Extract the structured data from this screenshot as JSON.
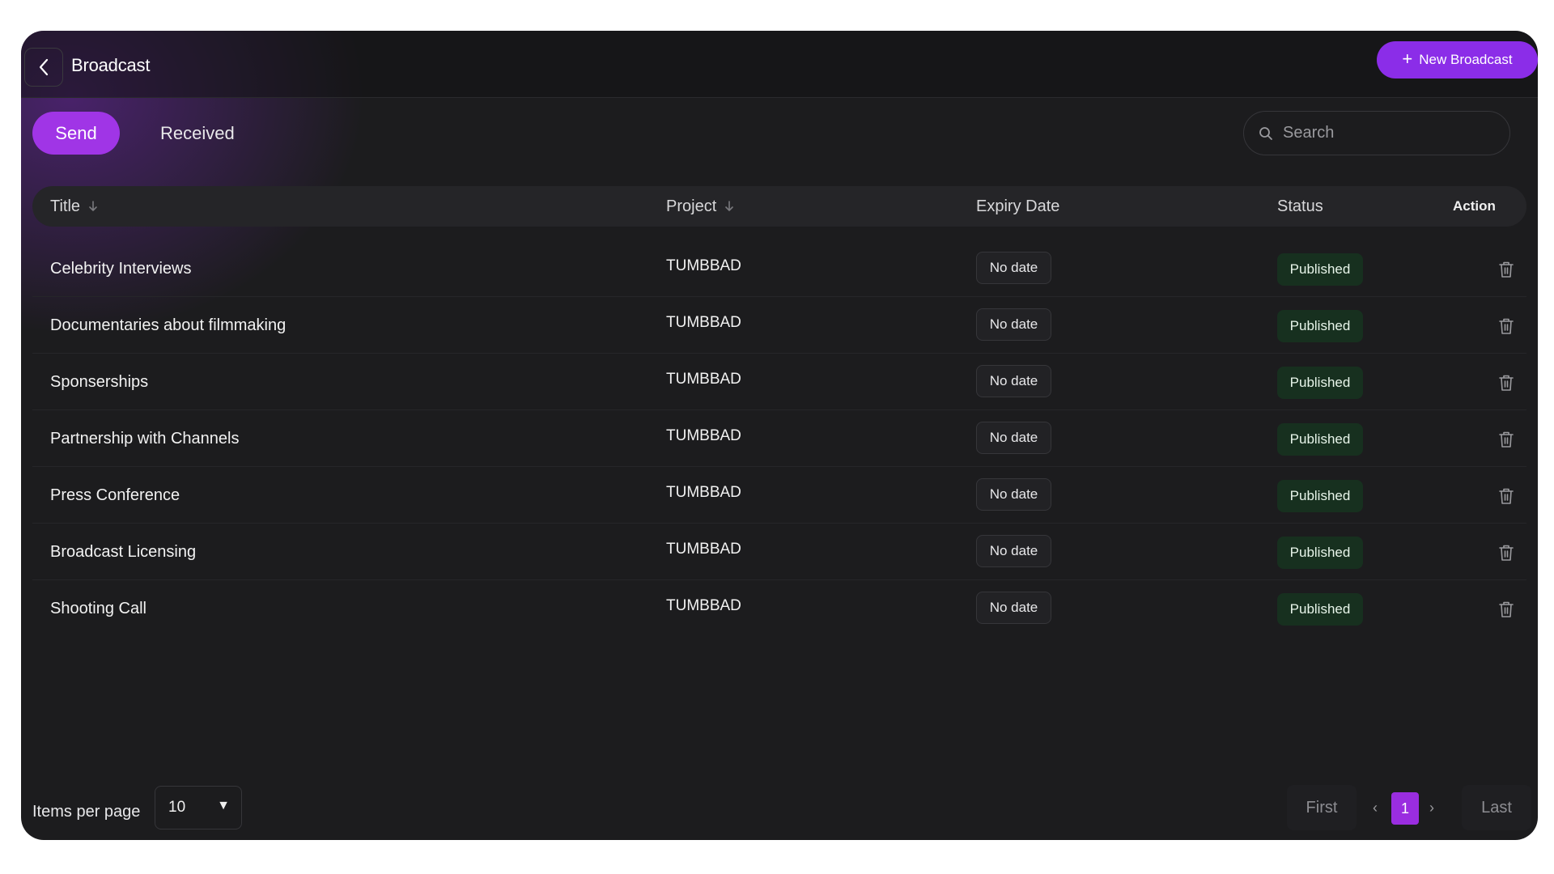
{
  "header": {
    "title": "Broadcast",
    "new_button_label": "New Broadcast"
  },
  "tabs": [
    {
      "label": "Send",
      "active": true
    },
    {
      "label": "Received",
      "active": false
    }
  ],
  "search": {
    "placeholder": "Search",
    "value": ""
  },
  "table": {
    "columns": {
      "title": "Title",
      "project": "Project",
      "expiry": "Expiry Date",
      "status": "Status",
      "action": "Action"
    },
    "rows": [
      {
        "title": "Celebrity Interviews",
        "project": "TUMBBAD",
        "expiry": "No date",
        "status": "Published"
      },
      {
        "title": "Documentaries about filmmaking",
        "project": "TUMBBAD",
        "expiry": "No date",
        "status": "Published"
      },
      {
        "title": "Sponserships",
        "project": "TUMBBAD",
        "expiry": "No date",
        "status": "Published"
      },
      {
        "title": "Partnership with Channels",
        "project": "TUMBBAD",
        "expiry": "No date",
        "status": "Published"
      },
      {
        "title": "Press Conference",
        "project": "TUMBBAD",
        "expiry": "No date",
        "status": "Published"
      },
      {
        "title": "Broadcast Licensing",
        "project": "TUMBBAD",
        "expiry": "No date",
        "status": "Published"
      },
      {
        "title": "Shooting Call",
        "project": "TUMBBAD",
        "expiry": "No date",
        "status": "Published"
      }
    ]
  },
  "footer": {
    "items_per_page_label": "Items per page",
    "items_per_page_value": "10",
    "first_label": "First",
    "last_label": "Last",
    "prev_glyph": "‹",
    "next_glyph": "›",
    "current_page": "1"
  },
  "colors": {
    "accent": "#8b2de8",
    "background": "#1c1c1e",
    "status_published_bg": "#17301f"
  },
  "icons": {
    "back": "chevron-left-icon",
    "add": "plus-icon",
    "search": "search-icon",
    "sort": "arrow-down-icon",
    "delete": "trash-icon",
    "dropdown": "caret-down-icon"
  }
}
